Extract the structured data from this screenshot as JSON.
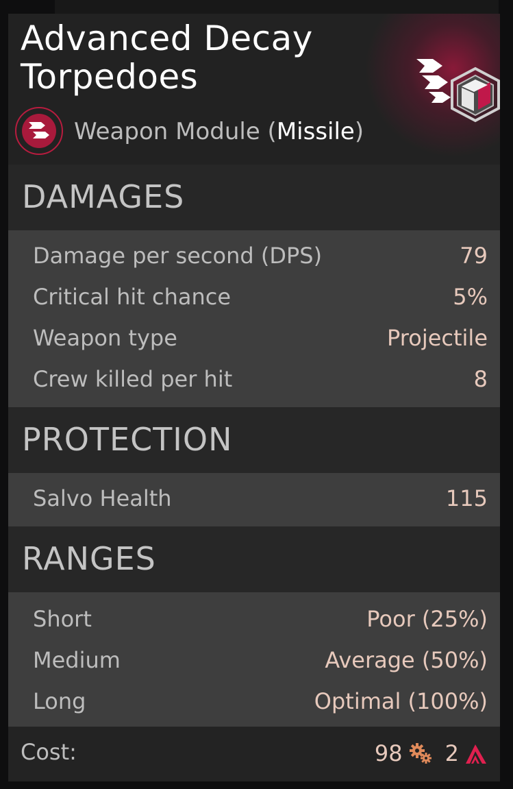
{
  "module": {
    "title": "Advanced Decay Torpedoes",
    "type_prefix": "Weapon Module (",
    "type_highlight": "Missile",
    "type_suffix": ")",
    "icon": "missile-icon",
    "category_icon": "module-cube-icon",
    "accent_color": "#c0184a"
  },
  "sections": {
    "damages": {
      "title": "DAMAGES",
      "rows": [
        {
          "label": "Damage per second (DPS)",
          "value": "79"
        },
        {
          "label": "Critical hit chance",
          "value": "5%"
        },
        {
          "label": "Weapon type",
          "value": "Projectile"
        },
        {
          "label": "Crew killed per hit",
          "value": "8"
        }
      ]
    },
    "protection": {
      "title": "PROTECTION",
      "rows": [
        {
          "label": "Salvo Health",
          "value": "115"
        }
      ]
    },
    "ranges": {
      "title": "RANGES",
      "rows": [
        {
          "label": "Short",
          "value": "Poor (25%)"
        },
        {
          "label": "Medium",
          "value": "Average (50%)"
        },
        {
          "label": "Long",
          "value": "Optimal (100%)"
        }
      ]
    }
  },
  "cost": {
    "label": "Cost:",
    "metal": "98",
    "metal_icon": "gear-cog-icon",
    "crew": "2",
    "crew_icon": "rank-chevron-icon"
  }
}
